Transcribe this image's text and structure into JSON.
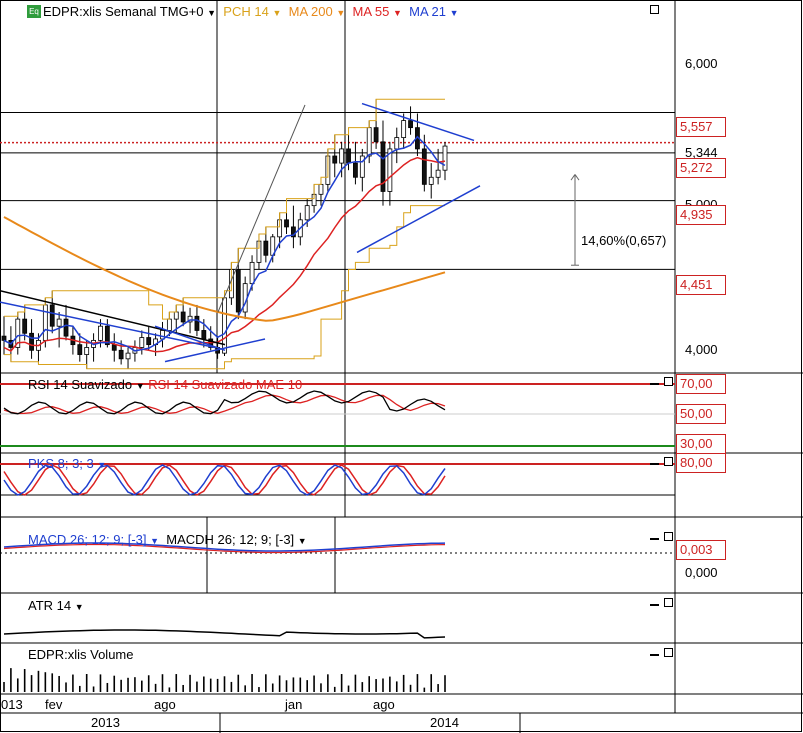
{
  "header": {
    "symbol": "EDPR:xlis Semanal TMG+0",
    "ind_pch": "PCH 14",
    "ind_ma200": "MA 200",
    "ind_ma55": "MA 55",
    "ind_ma21": "MA 21",
    "icon": "equity-icon"
  },
  "colors": {
    "pch": "#d9a21a",
    "ma200": "#e8891a",
    "ma55": "#dd2222",
    "ma21": "#1f3fd0",
    "badge": "#cc2222",
    "green_line": "#1c8a1c"
  },
  "price_axis": {
    "ticks": [
      "6,000",
      "5,000",
      "4,000"
    ],
    "hidden_tick": "5,344",
    "badges": [
      "5,557",
      "5,272",
      "4,935",
      "4,451"
    ]
  },
  "annotation": {
    "measure": "14,60%(0,657)"
  },
  "panels": {
    "rsi": {
      "name": "RSI 14 Suavizado",
      "signal": "RSI 14 Suavizado MAE 10",
      "levels": [
        "70,00",
        "50,00",
        "30,00"
      ]
    },
    "pks": {
      "name": "PKS 8; 3; 3",
      "level": "80,00"
    },
    "macd": {
      "name": "MACD 26; 12; 9; [-3]",
      "hist": "MACDH 26; 12; 9; [-3]",
      "value": "0,003",
      "zero": "0,000"
    },
    "atr": {
      "name": "ATR 14"
    },
    "volume": {
      "name": "EDPR:xlis Volume"
    }
  },
  "time_axis": {
    "months": [
      "013",
      "fev",
      "ago",
      "jan",
      "ago"
    ],
    "years": [
      "2013",
      "2014"
    ]
  },
  "chart_data": {
    "type": "candlestick",
    "title": "EDPR:xlis Semanal TMG+0",
    "ylim": [
      3.72,
      6.35
    ],
    "y_ticks": [
      4.0,
      5.0,
      6.0
    ],
    "horizontal_levels": [
      5.557,
      5.272,
      4.935,
      4.451
    ],
    "current_price_level": 5.344,
    "ohlc": [
      [
        3.98,
        4.12,
        3.85,
        3.95
      ],
      [
        3.95,
        4.05,
        3.8,
        3.9
      ],
      [
        3.9,
        4.15,
        3.85,
        4.1
      ],
      [
        4.1,
        4.2,
        3.95,
        4.0
      ],
      [
        4.0,
        4.1,
        3.82,
        3.88
      ],
      [
        3.88,
        4.0,
        3.78,
        3.95
      ],
      [
        3.95,
        4.25,
        3.9,
        4.2
      ],
      [
        4.2,
        4.3,
        4.0,
        4.05
      ],
      [
        4.05,
        4.15,
        3.9,
        4.1
      ],
      [
        4.1,
        4.2,
        3.95,
        3.98
      ],
      [
        3.98,
        4.05,
        3.85,
        3.92
      ],
      [
        3.92,
        4.0,
        3.8,
        3.85
      ],
      [
        3.85,
        3.95,
        3.75,
        3.9
      ],
      [
        3.9,
        4.0,
        3.8,
        3.95
      ],
      [
        3.95,
        4.1,
        3.9,
        4.05
      ],
      [
        4.05,
        4.1,
        3.9,
        3.92
      ],
      [
        3.92,
        4.0,
        3.8,
        3.88
      ],
      [
        3.88,
        3.95,
        3.78,
        3.82
      ],
      [
        3.82,
        3.9,
        3.75,
        3.86
      ],
      [
        3.86,
        3.95,
        3.8,
        3.9
      ],
      [
        3.9,
        4.02,
        3.85,
        3.97
      ],
      [
        3.97,
        4.05,
        3.88,
        3.92
      ],
      [
        3.92,
        4.0,
        3.84,
        3.96
      ],
      [
        3.96,
        4.08,
        3.9,
        4.02
      ],
      [
        4.02,
        4.15,
        3.98,
        4.1
      ],
      [
        4.1,
        4.2,
        4.0,
        4.15
      ],
      [
        4.15,
        4.25,
        4.05,
        4.08
      ],
      [
        4.08,
        4.18,
        4.0,
        4.12
      ],
      [
        4.12,
        4.2,
        3.98,
        4.02
      ],
      [
        4.02,
        4.1,
        3.9,
        3.96
      ],
      [
        3.96,
        4.05,
        3.88,
        3.9
      ],
      [
        3.9,
        3.98,
        3.82,
        3.86
      ],
      [
        3.86,
        4.3,
        3.84,
        4.25
      ],
      [
        4.25,
        4.5,
        4.2,
        4.45
      ],
      [
        4.45,
        4.6,
        4.1,
        4.15
      ],
      [
        4.15,
        4.4,
        4.1,
        4.35
      ],
      [
        4.35,
        4.55,
        4.3,
        4.5
      ],
      [
        4.5,
        4.7,
        4.45,
        4.65
      ],
      [
        4.65,
        4.75,
        4.5,
        4.55
      ],
      [
        4.55,
        4.7,
        4.5,
        4.68
      ],
      [
        4.68,
        4.85,
        4.6,
        4.8
      ],
      [
        4.8,
        4.95,
        4.7,
        4.75
      ],
      [
        4.75,
        4.9,
        4.6,
        4.68
      ],
      [
        4.68,
        4.85,
        4.62,
        4.8
      ],
      [
        4.8,
        4.95,
        4.75,
        4.9
      ],
      [
        4.9,
        5.05,
        4.85,
        4.98
      ],
      [
        4.98,
        5.1,
        4.9,
        5.05
      ],
      [
        5.05,
        5.3,
        5.0,
        5.25
      ],
      [
        5.25,
        5.4,
        5.1,
        5.2
      ],
      [
        5.2,
        5.35,
        5.1,
        5.3
      ],
      [
        5.3,
        5.45,
        5.15,
        5.2
      ],
      [
        5.2,
        5.35,
        5.05,
        5.1
      ],
      [
        5.1,
        5.3,
        5.0,
        5.25
      ],
      [
        5.25,
        5.5,
        5.2,
        5.45
      ],
      [
        5.45,
        5.65,
        5.3,
        5.35
      ],
      [
        5.35,
        5.5,
        4.9,
        5.0
      ],
      [
        5.0,
        5.35,
        4.9,
        5.3
      ],
      [
        5.3,
        5.45,
        5.2,
        5.38
      ],
      [
        5.38,
        5.55,
        5.3,
        5.5
      ],
      [
        5.5,
        5.6,
        5.4,
        5.45
      ],
      [
        5.45,
        5.55,
        5.25,
        5.3
      ],
      [
        5.3,
        5.4,
        5.0,
        5.05
      ],
      [
        5.05,
        5.2,
        4.95,
        5.1
      ],
      [
        5.1,
        5.3,
        5.05,
        5.15
      ],
      [
        5.15,
        5.35,
        5.08,
        5.32
      ]
    ],
    "series": [
      {
        "name": "PCH 14",
        "color": "#d9a21a"
      },
      {
        "name": "MA 200",
        "color": "#e8891a"
      },
      {
        "name": "MA 55",
        "color": "#dd2222"
      },
      {
        "name": "MA 21",
        "color": "#1f3fd0"
      }
    ]
  }
}
